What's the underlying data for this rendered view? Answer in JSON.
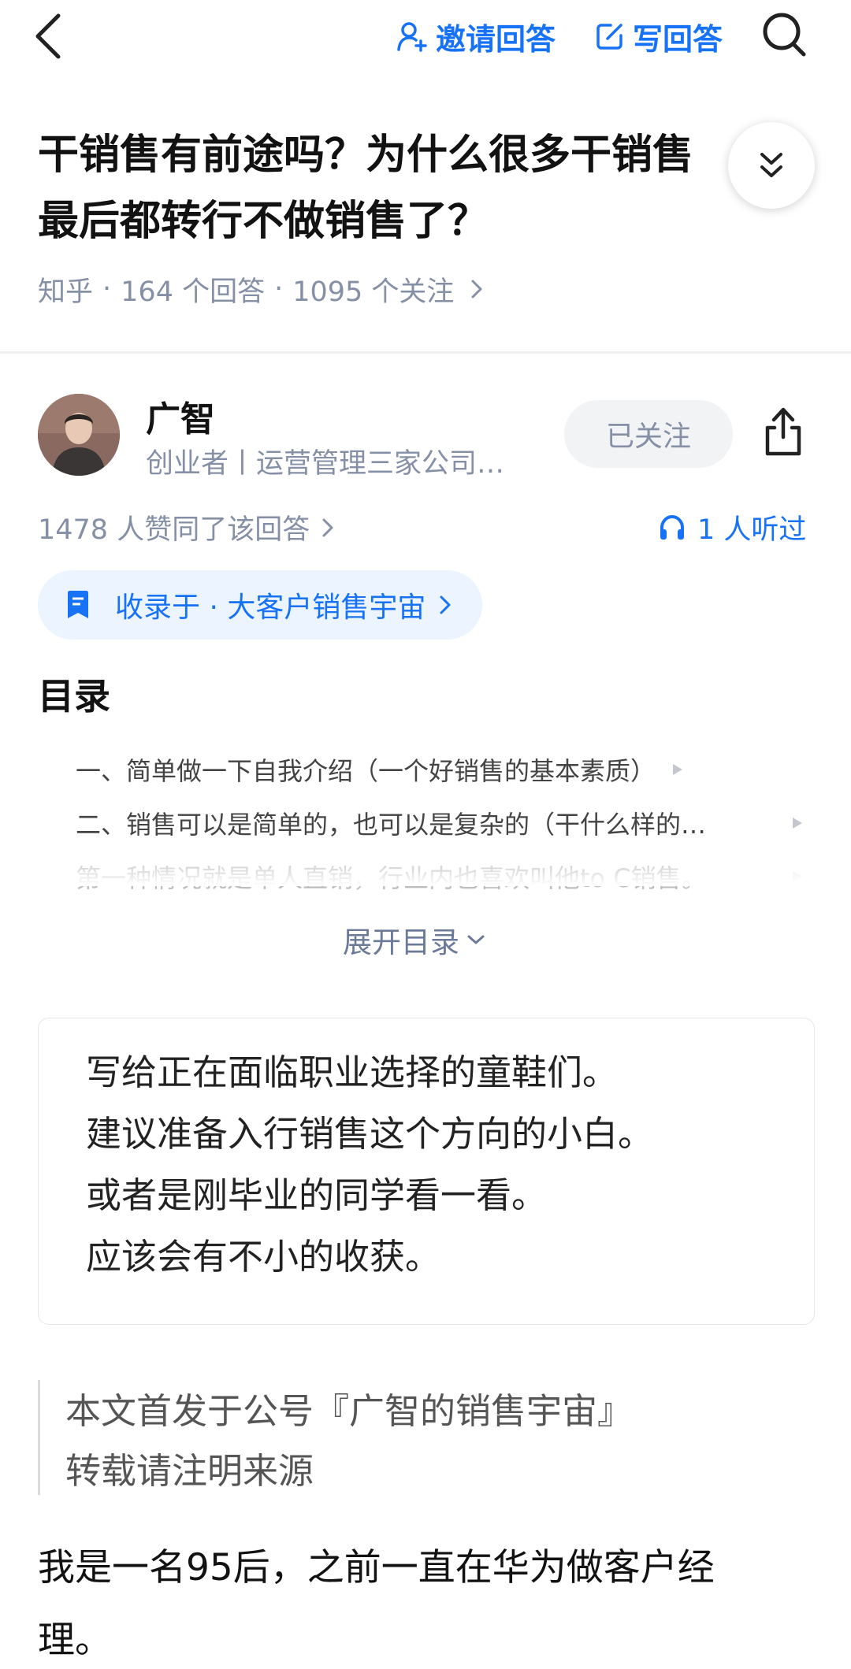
{
  "topbar": {
    "invite_label": "邀请回答",
    "write_label": "写回答"
  },
  "question": {
    "title_line1": "干销售有前途吗？为什么很多干销售",
    "title_line2": "最后都转行不做销售了？",
    "source": "知乎",
    "answers": "164 个回答",
    "followers": "1095 个关注",
    "sep": "·"
  },
  "author": {
    "name": "广智",
    "bio": "创业者丨运营管理三家公司…",
    "follow_label": "已关注"
  },
  "stats": {
    "agree": "1478 人赞同了该回答",
    "listened": "1 人听过"
  },
  "collection": {
    "label": "收录于 · 大客户销售宇宙"
  },
  "toc": {
    "heading": "目录",
    "items": [
      "一、简单做一下自我介绍（一个好销售的基本素质）",
      "二、销售可以是简单的，也可以是复杂的（干什么样的…",
      "第一种情况就是单人直销，行业内也喜欢叫他to C销售。"
    ],
    "expand_label": "展开目录"
  },
  "intro": {
    "lines": [
      "写给正在面临职业选择的童鞋们。",
      "建议准备入行销售这个方向的小白。",
      "或者是刚毕业的同学看一看。",
      "应该会有不小的收获。"
    ]
  },
  "quote": {
    "lines": [
      "本文首发于公号『广智的销售宇宙』",
      "转载请注明来源"
    ]
  },
  "body": {
    "line1": "我是一名95后，之前一直在华为做客户经",
    "line2": "理。"
  },
  "colors": {
    "accent": "#1772f6",
    "meta": "#8590a6"
  }
}
